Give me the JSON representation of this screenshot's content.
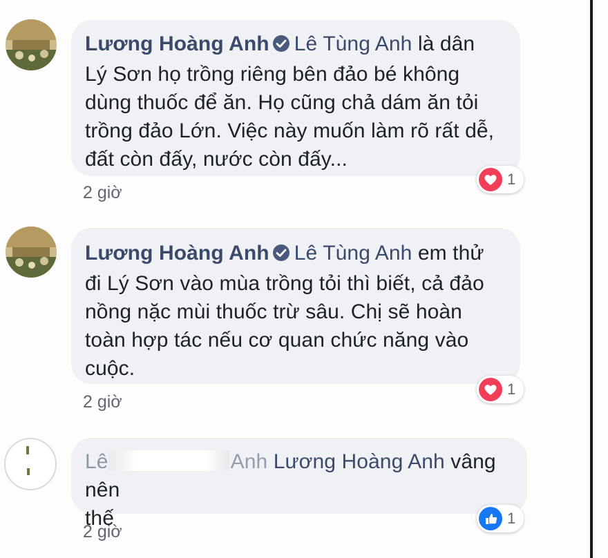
{
  "comments": [
    {
      "author": "Lương Hoàng Anh",
      "verified": true,
      "tagged": "Lê Tùng Anh",
      "lines": [
        " là dân",
        "Lý Sơn họ trồng riêng bên đảo bé không",
        "dùng thuốc để ăn. Họ cũng chả dám ăn tỏi",
        "trồng đảo Lớn. Việc này muốn làm rõ rất dễ,",
        "đất còn đấy, nước còn đấy..."
      ],
      "time": "2 giờ",
      "reaction_icon": "heart-icon",
      "reaction_count": "1"
    },
    {
      "author": "Lương Hoàng Anh",
      "verified": true,
      "tagged": "Lê Tùng Anh",
      "lines": [
        " em thử",
        "đi Lý Sơn vào mùa trồng tỏi thì biết, cả đảo",
        "nồng nặc mùi thuốc trừ sâu. Chị sẽ hoàn",
        "toàn hợp tác nếu cơ quan chức năng vào",
        "cuộc."
      ],
      "time": "2 giờ",
      "reaction_icon": "heart-icon",
      "reaction_count": "1"
    },
    {
      "author_partial_start": "Lê",
      "author_partial_end": "Anh",
      "tagged": "Lương Hoàng Anh",
      "lines": [
        " vâng nên",
        "thế"
      ],
      "time": "2 giờ",
      "reaction_icon": "like-icon",
      "reaction_count": "1"
    }
  ],
  "colors": {
    "bubble": "#eff1f4",
    "author": "#3b4a6b",
    "heart": "#f33e58",
    "like": "#1877f2",
    "time": "#616770"
  }
}
